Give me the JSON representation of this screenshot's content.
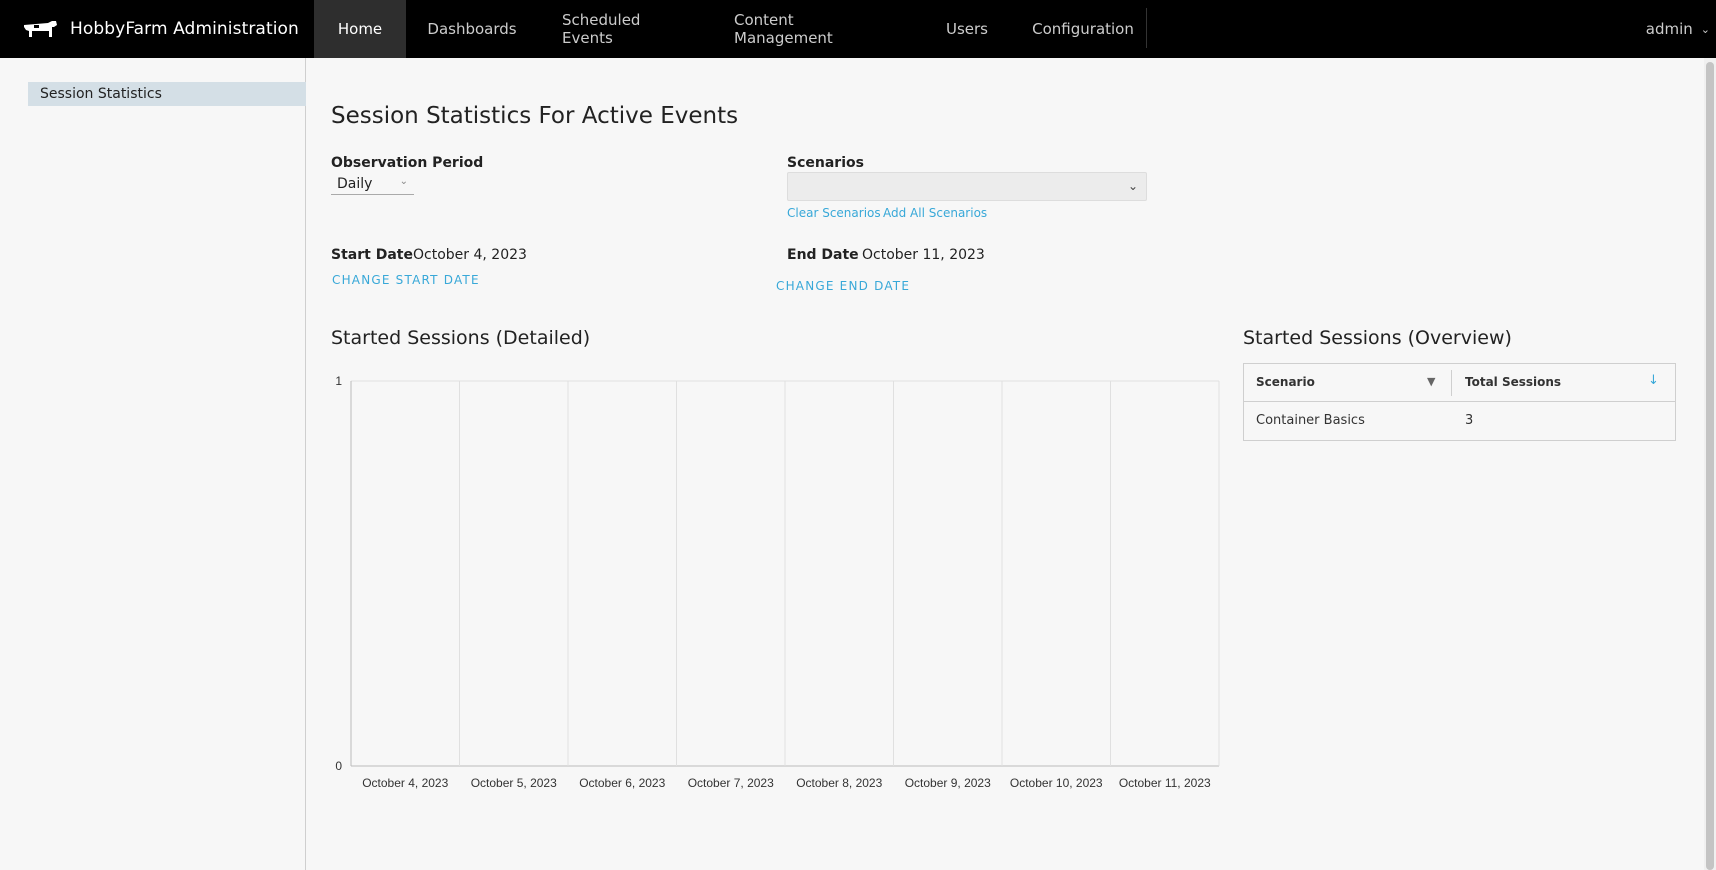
{
  "app": {
    "title": "HobbyFarm Administration",
    "logo_icon": "cow-icon"
  },
  "nav": {
    "items": [
      {
        "label": "Home",
        "active": true
      },
      {
        "label": "Dashboards",
        "active": false
      },
      {
        "label": "Scheduled Events",
        "active": false
      },
      {
        "label": "Content Management",
        "active": false
      },
      {
        "label": "Users",
        "active": false
      },
      {
        "label": "Configuration",
        "active": false
      }
    ],
    "user": "admin",
    "user_caret_icon": "chevron-down-icon"
  },
  "sidebar": {
    "items": [
      {
        "label": "Session Statistics",
        "active": true
      }
    ]
  },
  "page": {
    "title": "Session Statistics For Active Events"
  },
  "filters": {
    "observation_period_label": "Observation Period",
    "observation_period_value": "Daily",
    "scenarios_label": "Scenarios",
    "scenarios_value": "",
    "clear_scenarios": "Clear Scenarios",
    "add_all_scenarios": "Add All Scenarios",
    "start_date_label": "Start Date",
    "start_date_value": "October 4, 2023",
    "change_start_date": "CHANGE START DATE",
    "end_date_label": "End Date",
    "end_date_value": "October 11, 2023",
    "change_end_date": "CHANGE END DATE"
  },
  "detailed": {
    "title": "Started Sessions (Detailed)"
  },
  "overview": {
    "title": "Started Sessions (Overview)",
    "columns": [
      "Scenario",
      "Total Sessions"
    ],
    "filter_icon": "filter-icon",
    "sort_icon": "arrow-down-icon",
    "rows": [
      {
        "scenario": "Container Basics",
        "total": "3"
      }
    ]
  },
  "colors": {
    "accent": "#38a8d8",
    "navbar": "#000000",
    "nav_active": "#2e2e2e",
    "sidebar_active": "#d4dfe6"
  },
  "chart_data": {
    "type": "bar",
    "categories": [
      "October 4, 2023",
      "October 5, 2023",
      "October 6, 2023",
      "October 7, 2023",
      "October 8, 2023",
      "October 9, 2023",
      "October 10, 2023",
      "October 11, 2023"
    ],
    "series": [],
    "yticks": [
      "0",
      "1"
    ],
    "ylim": [
      0,
      1
    ],
    "grid": true,
    "title": "",
    "xlabel": "",
    "ylabel": ""
  }
}
